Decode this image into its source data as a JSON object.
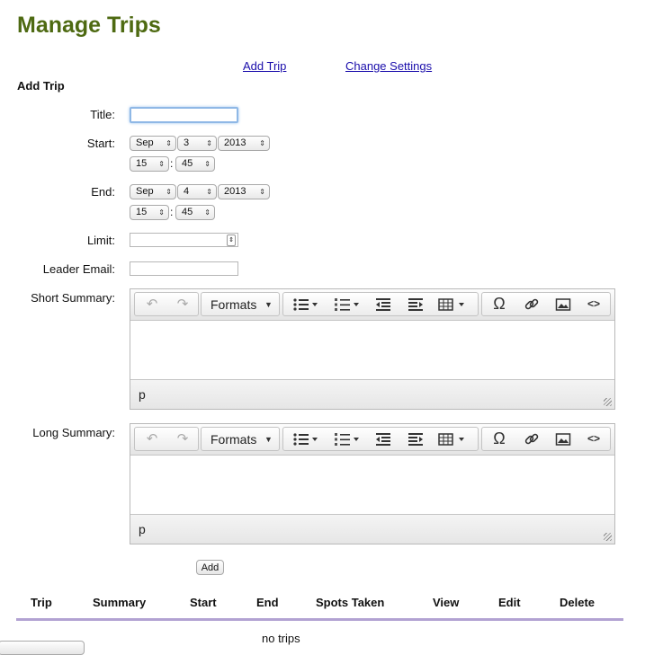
{
  "page_title": "Manage Trips",
  "links": {
    "add_trip": "Add Trip",
    "change_settings": "Change Settings"
  },
  "section_heading": "Add Trip",
  "form": {
    "title_label": "Title:",
    "title_value": "",
    "start_label": "Start:",
    "start": {
      "month": "Sep",
      "day": "3",
      "year": "2013",
      "hour": "15",
      "minute": "45"
    },
    "end_label": "End:",
    "end": {
      "month": "Sep",
      "day": "4",
      "year": "2013",
      "hour": "15",
      "minute": "45"
    },
    "time_separator": ":",
    "limit_label": "Limit:",
    "limit_value": "",
    "leader_email_label": "Leader Email:",
    "leader_email_value": "",
    "short_summary_label": "Short Summary:",
    "long_summary_label": "Long Summary:",
    "add_button": "Add"
  },
  "editor": {
    "formats_label": "Formats",
    "status_path": "p",
    "icons": [
      "undo-icon",
      "redo-icon",
      "bullet-list-icon",
      "numbered-list-icon",
      "outdent-icon",
      "indent-icon",
      "table-icon",
      "omega-icon",
      "link-icon",
      "image-icon",
      "code-icon"
    ],
    "glyphs": {
      "undo": "↶",
      "redo": "↷",
      "caret": "▼",
      "omega": "Ω",
      "code": "<>"
    }
  },
  "table": {
    "headers": [
      "Trip",
      "Summary",
      "Start",
      "End",
      "Spots Taken",
      "View",
      "Edit",
      "Delete"
    ],
    "empty_text": "no trips"
  },
  "select_arrow": "⇕",
  "colors": {
    "title": "#4e6a12",
    "link": "#1a0dab",
    "rule": "#b2a2d2"
  }
}
